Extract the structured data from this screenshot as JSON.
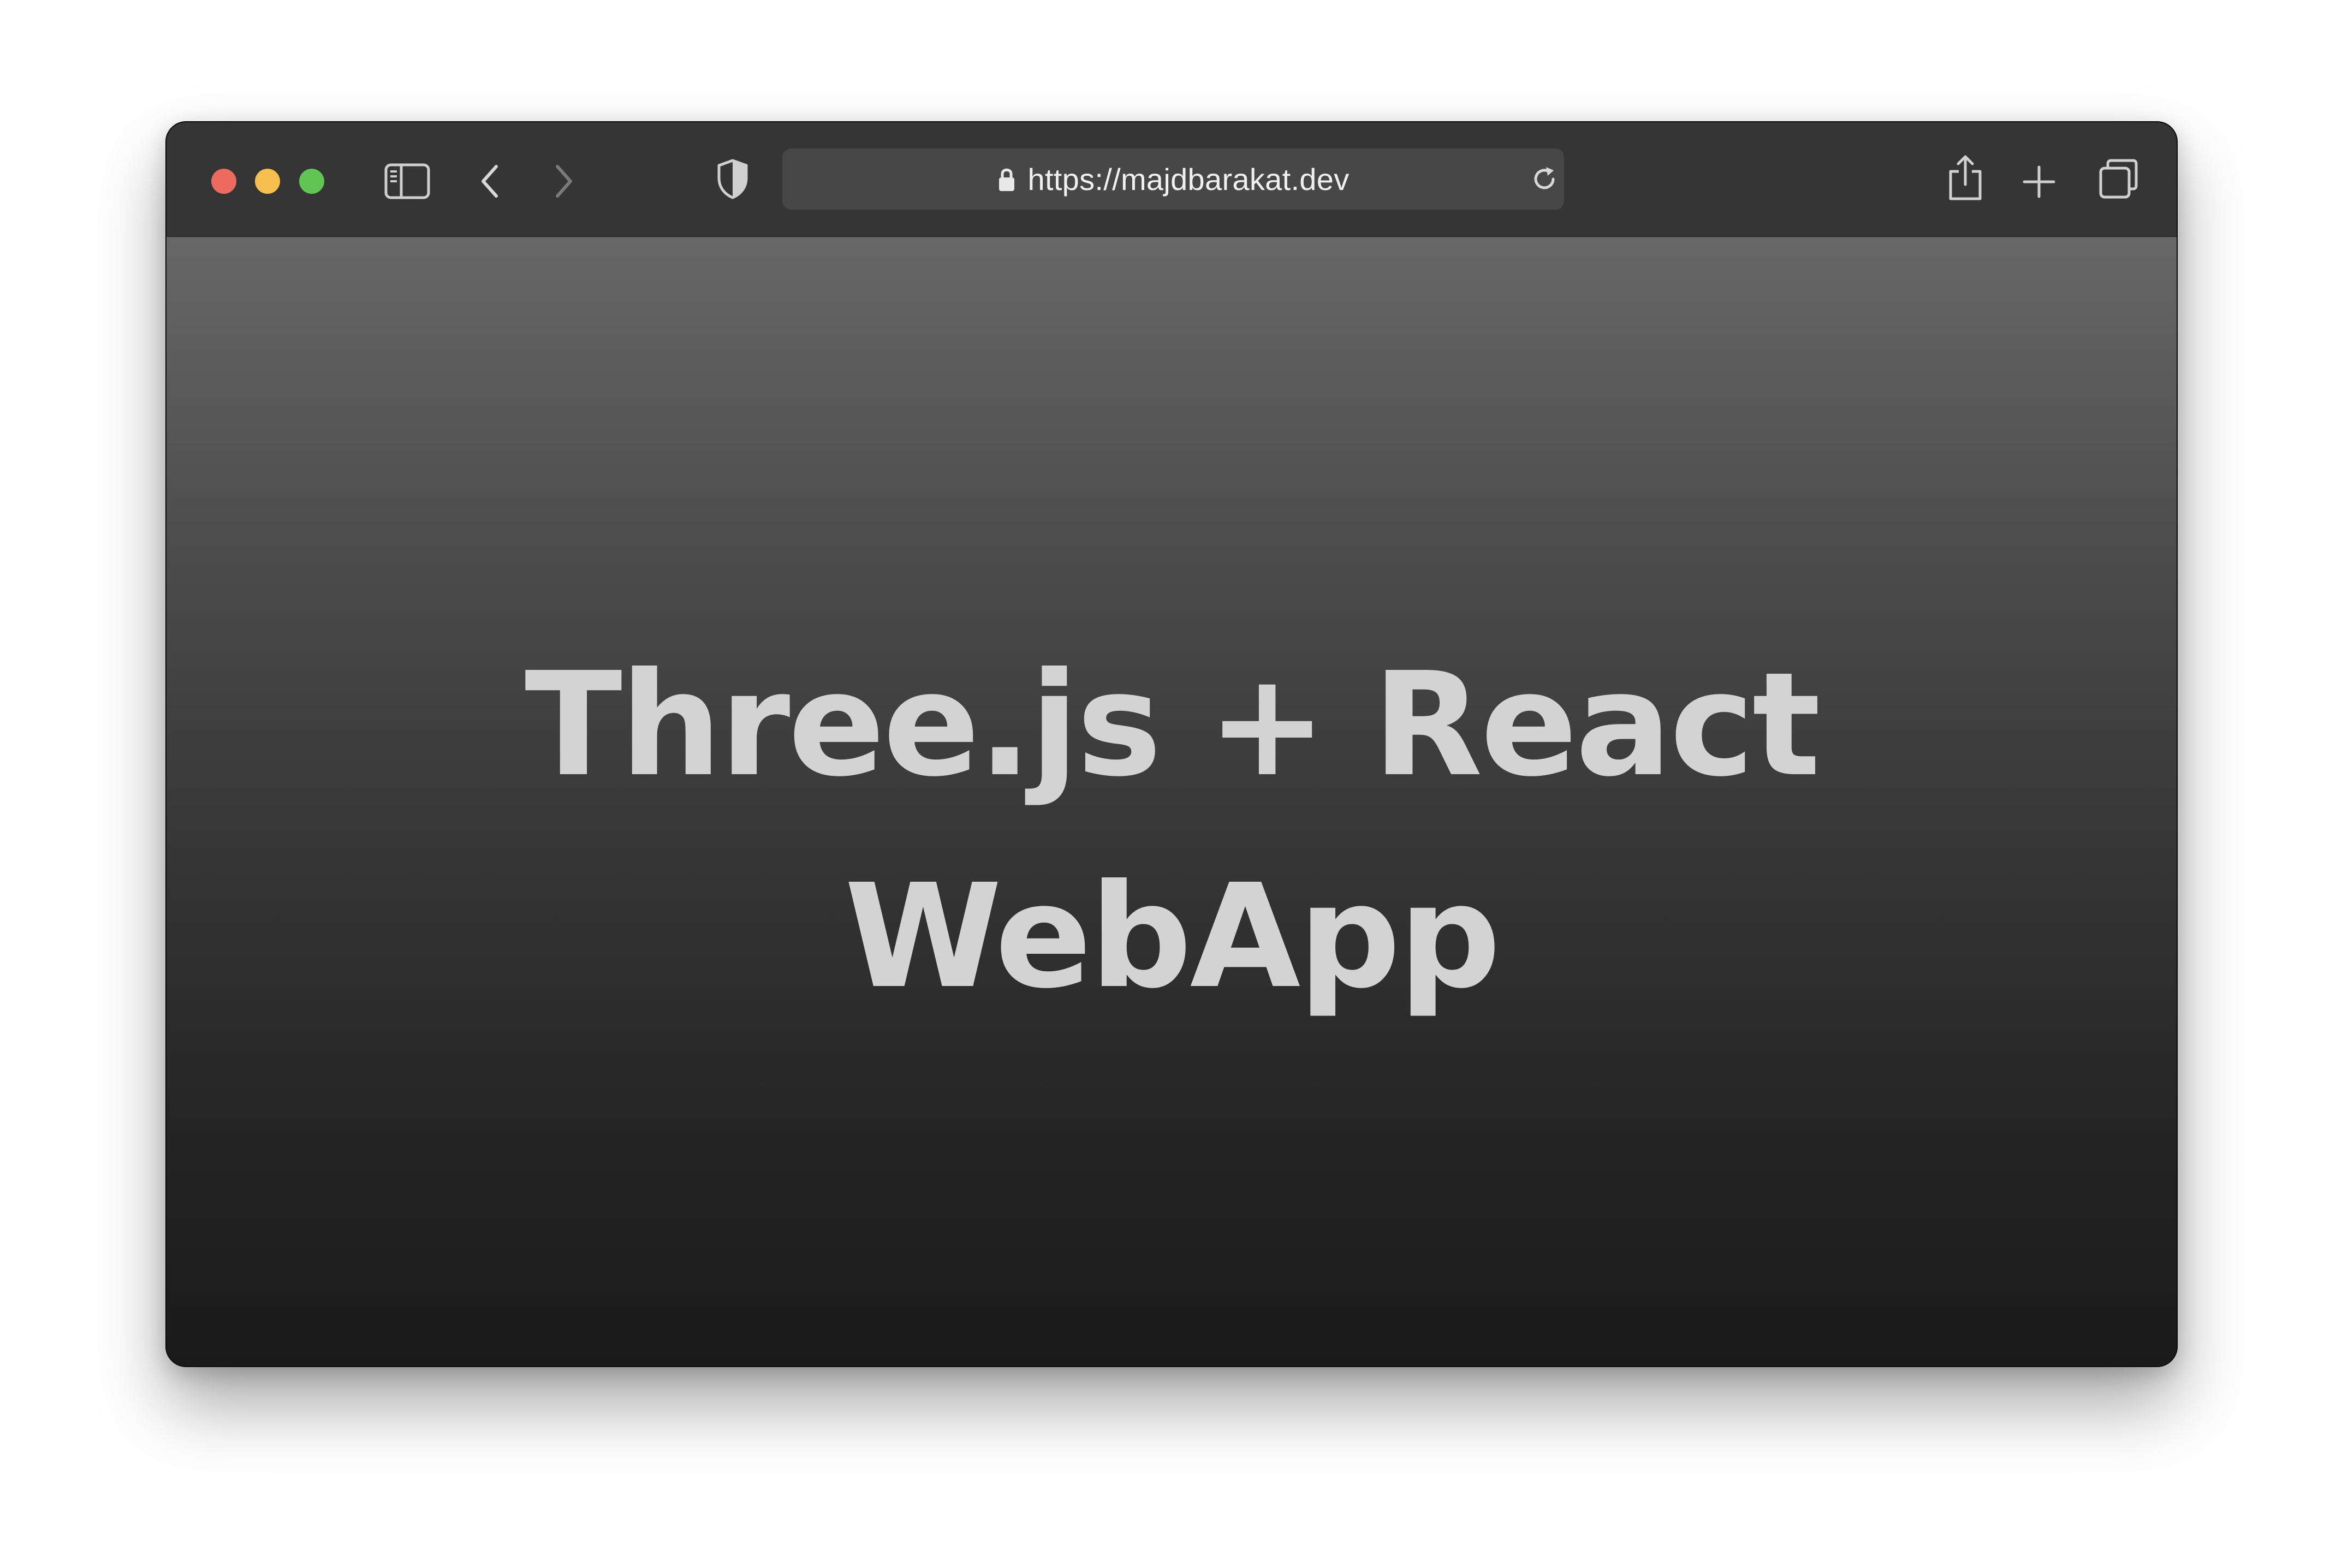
{
  "browser": {
    "address_bar": {
      "url": "https://majdbarakat.dev"
    },
    "icons": {
      "sidebar": "sidebar-toggle-icon",
      "back": "chevron-left-icon",
      "forward": "chevron-right-icon",
      "privacy": "shield-icon",
      "lock": "lock-icon",
      "reload": "reload-icon",
      "share": "share-icon",
      "new_tab": "plus-icon",
      "tabs_overview": "tabs-overview-icon"
    },
    "colors": {
      "close": "#ec6a5e",
      "minimize": "#f4bf4f",
      "zoom": "#61c554",
      "toolbar": "#353535",
      "address_bar": "#474747",
      "headline_text": "#d3d3d3"
    }
  },
  "page": {
    "headline": {
      "line1": "Three.js + React",
      "line2": "WebApp"
    }
  }
}
